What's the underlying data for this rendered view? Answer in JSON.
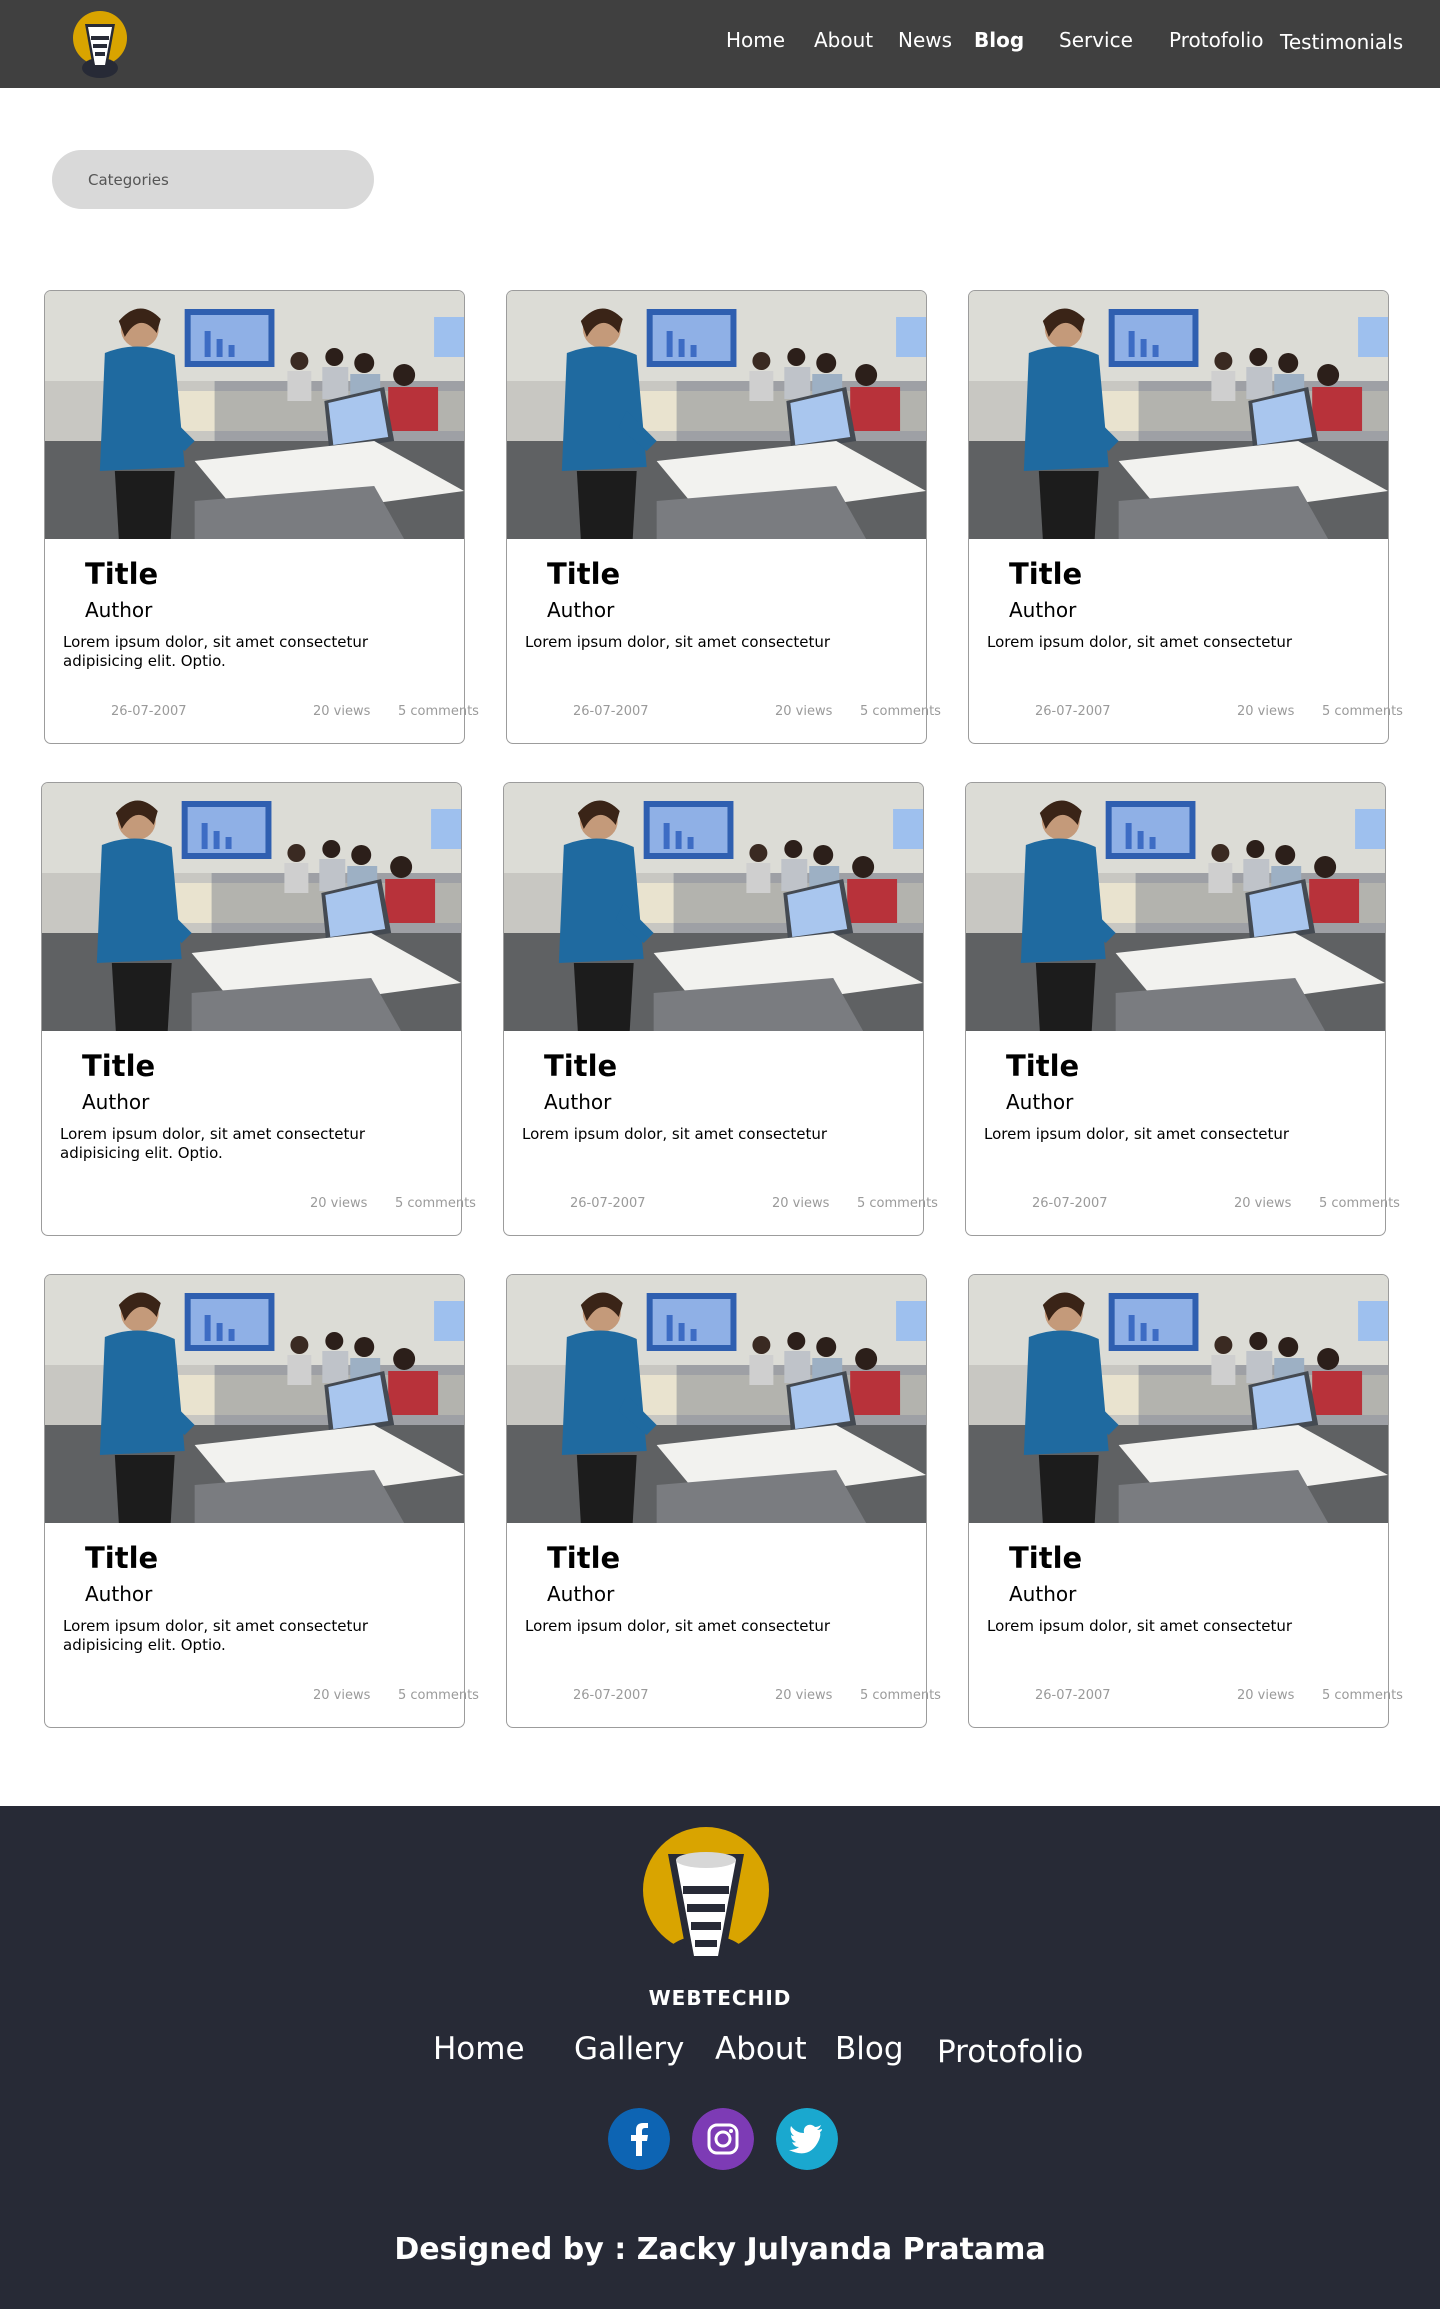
{
  "header": {
    "nav": [
      {
        "label": "Home"
      },
      {
        "label": "About"
      },
      {
        "label": "News"
      },
      {
        "label": "Blog"
      },
      {
        "label": "Service"
      },
      {
        "label": "Protofolio"
      },
      {
        "label": "Testimonials"
      }
    ],
    "active_nav": "Blog"
  },
  "categories": {
    "label": "Categories"
  },
  "cards": [
    {
      "title": "Title",
      "author": "Author",
      "excerpt": "Lorem ipsum dolor, sit amet consectetur adipisicing elit. Optio.",
      "date": "26-07-2007",
      "views": "20 views",
      "comments": "5 comments"
    },
    {
      "title": "Title",
      "author": "Author",
      "excerpt": "Lorem ipsum dolor, sit amet consectetur",
      "date": "26-07-2007",
      "views": "20 views",
      "comments": "5 comments"
    },
    {
      "title": "Title",
      "author": "Author",
      "excerpt": "Lorem ipsum dolor, sit amet consectetur",
      "date": "26-07-2007",
      "views": "20 views",
      "comments": "5 comments"
    },
    {
      "title": "Title",
      "author": "Author",
      "excerpt": "Lorem ipsum dolor, sit amet consectetur adipisicing elit. Optio.",
      "date": "",
      "views": "20 views",
      "comments": "5 comments"
    },
    {
      "title": "Title",
      "author": "Author",
      "excerpt": "Lorem ipsum dolor, sit amet consectetur",
      "date": "26-07-2007",
      "views": "20 views",
      "comments": "5 comments"
    },
    {
      "title": "Title",
      "author": "Author",
      "excerpt": "Lorem ipsum dolor, sit amet consectetur",
      "date": "26-07-2007",
      "views": "20 views",
      "comments": "5 comments"
    },
    {
      "title": "Title",
      "author": "Author",
      "excerpt": "Lorem ipsum dolor, sit amet consectetur adipisicing elit. Optio.",
      "date": "",
      "views": "20 views",
      "comments": "5 comments"
    },
    {
      "title": "Title",
      "author": "Author",
      "excerpt": "Lorem ipsum dolor, sit amet consectetur",
      "date": "26-07-2007",
      "views": "20 views",
      "comments": "5 comments"
    },
    {
      "title": "Title",
      "author": "Author",
      "excerpt": "Lorem ipsum dolor, sit amet consectetur",
      "date": "26-07-2007",
      "views": "20 views",
      "comments": "5 comments"
    }
  ],
  "footer": {
    "brand": "WEBTECHID",
    "nav": [
      {
        "label": "Home"
      },
      {
        "label": "Gallery"
      },
      {
        "label": "About"
      },
      {
        "label": "Blog"
      },
      {
        "label": "Protofolio"
      }
    ],
    "social": [
      {
        "icon": "facebook-icon",
        "color": "#0d64b3"
      },
      {
        "icon": "instagram-icon",
        "color": "#7d3bb5"
      },
      {
        "icon": "twitter-icon",
        "color": "#1aa8cf"
      }
    ],
    "credit": "Designed by : Zacky Julyanda Pratama"
  },
  "colors": {
    "header_bg": "#404040",
    "footer_bg": "#272a36",
    "logo_yellow": "#d9a400",
    "categories_bg": "#d9d9d9"
  }
}
